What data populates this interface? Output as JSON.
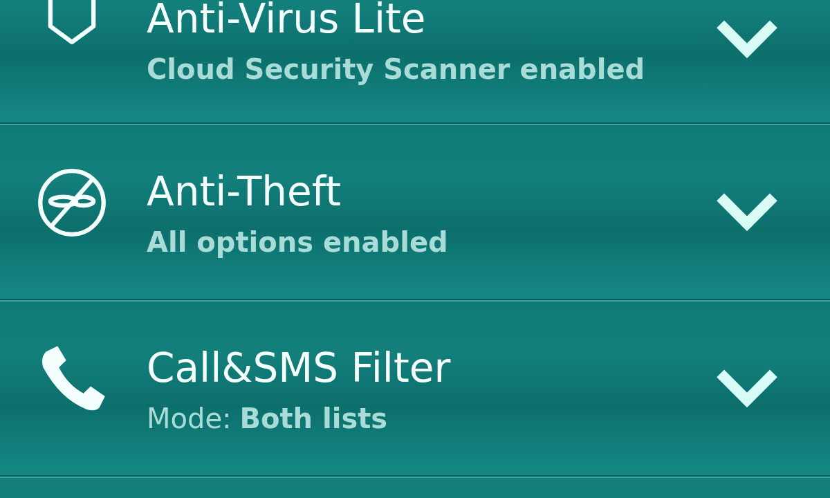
{
  "components": [
    {
      "kind": "shield",
      "title": "Anti-Virus Lite",
      "status": "Cloud Security Scanner enabled",
      "expanded": false
    },
    {
      "kind": "no-theft",
      "title": "Anti-Theft",
      "status": "All options enabled",
      "expanded": false
    },
    {
      "kind": "phone",
      "title": "Call&SMS Filter",
      "status_label": "Mode:",
      "status": "Both lists",
      "expanded": false
    }
  ]
}
